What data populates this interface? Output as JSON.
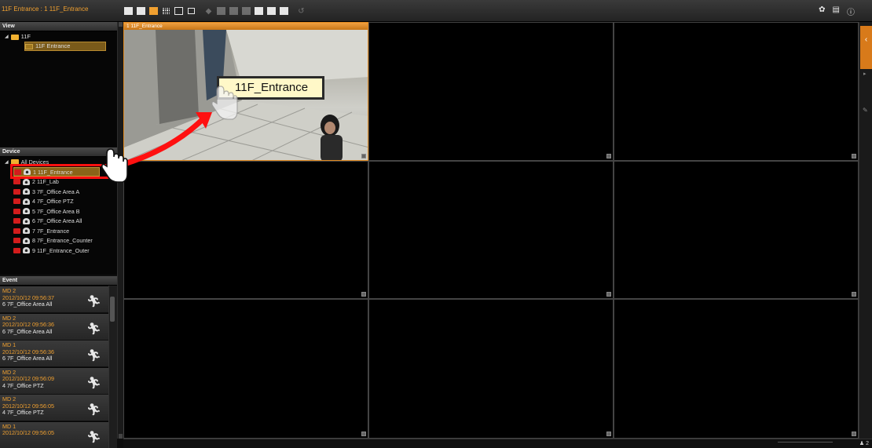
{
  "app": {
    "title": "11F Entrance : 1 11F_Entrance"
  },
  "toolbar": {
    "layouts": [
      "layout-1x1",
      "layout-2x2",
      "layout-3x3",
      "layout-4x4",
      "layout-custom",
      "layout-popout"
    ],
    "active_layout": "layout-3x3"
  },
  "view_panel": {
    "header": "View",
    "folder": "11F",
    "selected_view": "11F Entrance"
  },
  "device_panel": {
    "header": "Device",
    "root": "All Devices",
    "devices": [
      {
        "label": "1 11F_Entrance",
        "selected": true
      },
      {
        "label": "2 11F_Lab"
      },
      {
        "label": "3 7F_Office Area A"
      },
      {
        "label": "4 7F_Office PTZ"
      },
      {
        "label": "5 7F_Office Area B"
      },
      {
        "label": "6 7F_Office Area All"
      },
      {
        "label": "7 7F_Entrance"
      },
      {
        "label": "8 7F_Entrance_Counter"
      },
      {
        "label": "9 11F_Entrance_Outer"
      }
    ]
  },
  "event_panel": {
    "header": "Event",
    "events": [
      {
        "type": "MD 2",
        "time": "2012/10/12 09:56:37",
        "camera": "6 7F_Office Area All"
      },
      {
        "type": "MD 2",
        "time": "2012/10/12 09:56:36",
        "camera": "6 7F_Office Area All"
      },
      {
        "type": "MD 1",
        "time": "2012/10/12 09:56:36",
        "camera": "6 7F_Office Area All"
      },
      {
        "type": "MD 2",
        "time": "2012/10/12 09:56:09",
        "camera": "4 7F_Office PTZ"
      },
      {
        "type": "MD 2",
        "time": "2012/10/12 09:56:05",
        "camera": "4 7F_Office PTZ"
      },
      {
        "type": "MD 1",
        "time": "2012/10/12 09:56:05",
        "camera": ""
      }
    ]
  },
  "video_grid": {
    "tiles": [
      {
        "label": "1 11F_Entrance",
        "active": true
      },
      {
        "label": ""
      },
      {
        "label": ""
      },
      {
        "label": ""
      },
      {
        "label": ""
      },
      {
        "label": ""
      },
      {
        "label": ""
      },
      {
        "label": ""
      },
      {
        "label": ""
      }
    ]
  },
  "drop_popup": {
    "text": "11F_Entrance"
  },
  "status_bar": {
    "count": "2"
  },
  "colors": {
    "accent": "#f0a030",
    "highlight": "#ff1010",
    "rec": "#d21c1c"
  }
}
